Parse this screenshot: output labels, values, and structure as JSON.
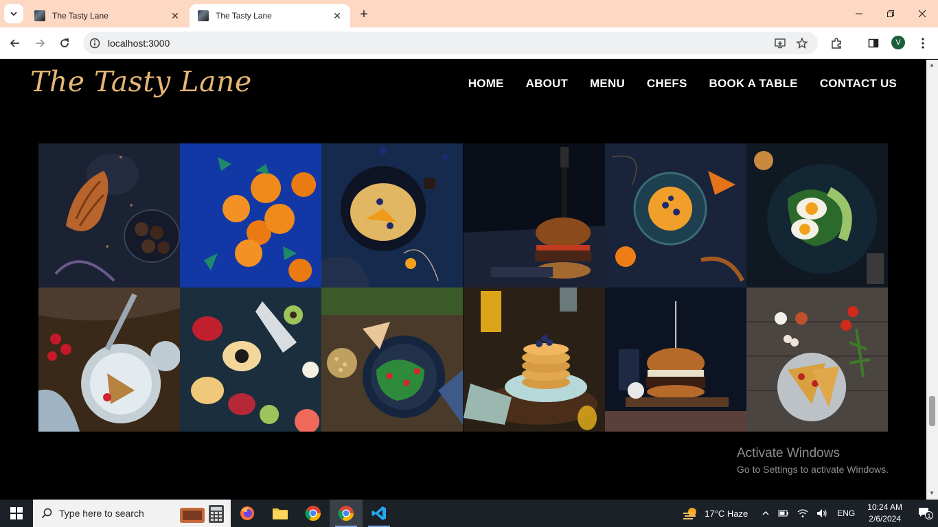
{
  "browser": {
    "tabs": [
      {
        "title": "The Tasty Lane",
        "active": false
      },
      {
        "title": "The Tasty Lane",
        "active": true
      }
    ],
    "url": "localhost:3000",
    "profile_initial": "V",
    "close_glyph": "✕",
    "new_tab_glyph": "+"
  },
  "site": {
    "logo": "The Tasty Lane",
    "nav": [
      "HOME",
      "ABOUT",
      "MENU",
      "CHEFS",
      "BOOK A TABLE",
      "CONTACT US"
    ],
    "gallery": [
      {
        "name": "croissant-and-truffles",
        "bg": "#1c2336"
      },
      {
        "name": "oranges-on-blue",
        "bg": "#1239a8"
      },
      {
        "name": "skillet-pancake-blueberries",
        "bg": "#16294d"
      },
      {
        "name": "burger-with-knife",
        "bg": "#0b0f1a"
      },
      {
        "name": "pancakes-orange-slices",
        "bg": "#1a2535"
      },
      {
        "name": "eggs-avocado-salad",
        "bg": "#121a24"
      },
      {
        "name": "pie-slice-strawberries",
        "bg": "#3b2a1e"
      },
      {
        "name": "papaya-kiwi-pomegranate",
        "bg": "#1d3040"
      },
      {
        "name": "chickpea-salad-bowl",
        "bg": "#4b3b2a"
      },
      {
        "name": "pancake-stack-blueberries",
        "bg": "#2c2218"
      },
      {
        "name": "burger-on-board",
        "bg": "#0d1524"
      },
      {
        "name": "pizza-slices-on-wood",
        "bg": "#4a4540"
      }
    ]
  },
  "watermark": {
    "title": "Activate Windows",
    "subtitle": "Go to Settings to activate Windows."
  },
  "taskbar": {
    "search_placeholder": "Type here to search",
    "weather": "17°C  Haze",
    "lang": "ENG",
    "time": "10:24 AM",
    "date": "2/6/2024",
    "notifications": "1",
    "apps": [
      "firefox-icon",
      "file-explorer-icon",
      "chrome-icon",
      "chrome-icon",
      "vscode-icon"
    ]
  },
  "colors": {
    "logo": "#e6b677",
    "tabstrip": "#fdd8c3",
    "taskbar": "#1c2128"
  }
}
